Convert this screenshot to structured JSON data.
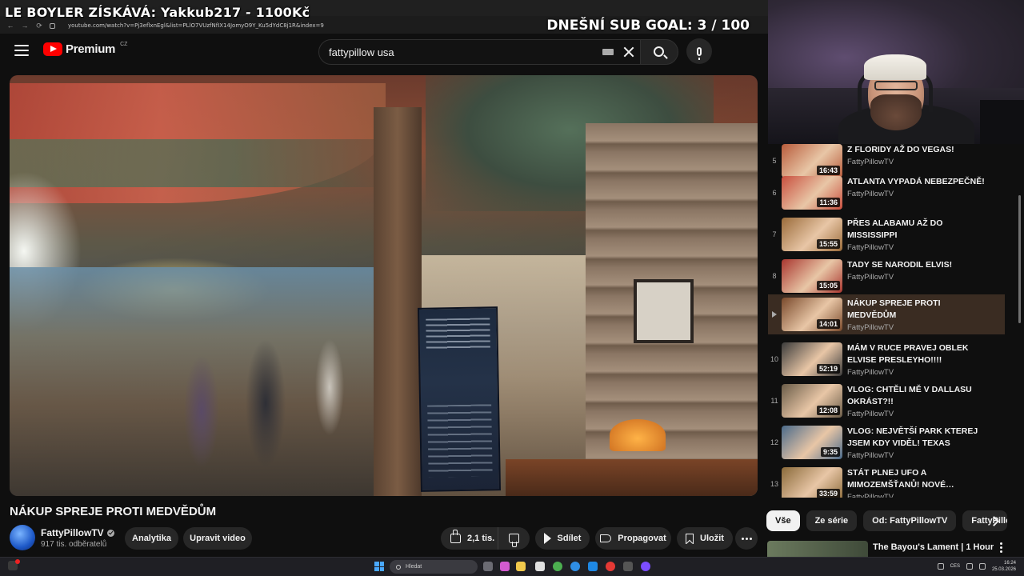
{
  "stream_overlay": {
    "donation_text": "LE BOYLER ZÍSKÁVÁ: Yakkub217 - 1100Kč",
    "sub_goal_text": "DNEŠNÍ SUB GOAL: 3 / 100"
  },
  "browser": {
    "url": "youtube.com/watch?v=Pj3eflxnEgl&list=PLlO7VUzfNfIX14JomyO9Y_Ku5dYdC8j1R&index=9"
  },
  "header": {
    "logo_text": "Premium",
    "logo_region": "CZ",
    "search_query": "fattypillow usa"
  },
  "video": {
    "title": "NÁKUP SPREJE PROTI MEDVĚDŮM",
    "channel": "FattyPillowTV",
    "subscribers": "917 tis. odběratelů",
    "likes": "2,1 tis."
  },
  "actions": {
    "analytics": "Analytika",
    "edit_video": "Upravit video",
    "share": "Sdílet",
    "promote": "Propagovat",
    "save": "Uložit"
  },
  "playlist": {
    "items": [
      {
        "index": "5",
        "title": "Z FLORIDY AŽ DO VEGAS!",
        "channel": "FattyPillowTV",
        "duration": "16:43",
        "active": false
      },
      {
        "index": "6",
        "title": "ATLANTA VYPADÁ NEBEZPEČNĚ!",
        "channel": "FattyPillowTV",
        "duration": "11:36",
        "active": false
      },
      {
        "index": "7",
        "title": "PŘES ALABAMU AŽ DO MISSISSIPPI",
        "channel": "FattyPillowTV",
        "duration": "15:55",
        "active": false
      },
      {
        "index": "8",
        "title": "TADY SE NARODIL ELVIS!",
        "channel": "FattyPillowTV",
        "duration": "15:05",
        "active": false
      },
      {
        "index": "",
        "title": "NÁKUP SPREJE PROTI MEDVĚDŮM",
        "channel": "FattyPillowTV",
        "duration": "14:01",
        "active": true
      },
      {
        "index": "10",
        "title": "MÁM V RUCE PRAVEJ OBLEK ELVISE PRESLEYHO!!!!",
        "channel": "FattyPillowTV",
        "duration": "52:19",
        "active": false
      },
      {
        "index": "11",
        "title": "VLOG: CHTĚLI MĚ V DALLASU OKRÁST?!!",
        "channel": "FattyPillowTV",
        "duration": "12:08",
        "active": false
      },
      {
        "index": "12",
        "title": "VLOG: NEJVĚTŠÍ PARK KTEREJ JSEM KDY VIDĚL! TEXAS",
        "channel": "FattyPillowTV",
        "duration": "9:35",
        "active": false
      },
      {
        "index": "13",
        "title": "STÁT PLNEJ UFO A MIMOZEMŠŤANŮ! NOVÉ…",
        "channel": "FattyPillowTV",
        "duration": "33:59",
        "active": false
      }
    ]
  },
  "chips": [
    "Vše",
    "Ze série",
    "Od: FattyPillowTV",
    "FattyPille"
  ],
  "recommendation": {
    "title": "The Bayou's Lament | 1 Hour"
  },
  "taskbar": {
    "search_placeholder": "Hledat",
    "language": "CES",
    "time": "16:24",
    "date": "25.03.2026"
  }
}
